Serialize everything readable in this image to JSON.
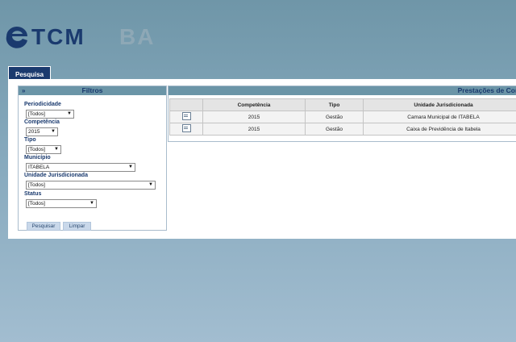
{
  "logo": {
    "text_bold": "eTCM",
    "text_light": "BA"
  },
  "tabs": [
    {
      "label": "Pesquisa"
    }
  ],
  "filters": {
    "title": "Filtros",
    "periodicidade": {
      "label": "Periodicidade",
      "value": "[Todos]"
    },
    "competencia": {
      "label": "Competência",
      "value": "2015"
    },
    "tipo": {
      "label": "Tipo",
      "value": "[Todos]"
    },
    "municipio": {
      "label": "Município",
      "value": "ITABELA"
    },
    "unidade": {
      "label": "Unidade Jurisdicionada",
      "value": "[Todos]"
    },
    "status": {
      "label": "Status",
      "value": "[Todos]"
    },
    "search_label": "Pesquisar",
    "clear_label": "Limpar"
  },
  "results": {
    "title": "Prestações de Cont",
    "columns": [
      "",
      "Competência",
      "Tipo",
      "Unidade Jurisdicionada"
    ],
    "rows": [
      {
        "competencia": "2015",
        "tipo": "Gestão",
        "unidade": "Camara Municipal de ITABELA"
      },
      {
        "competencia": "2015",
        "tipo": "Gestão",
        "unidade": "Caixa de Previdência de Itabela"
      }
    ]
  }
}
